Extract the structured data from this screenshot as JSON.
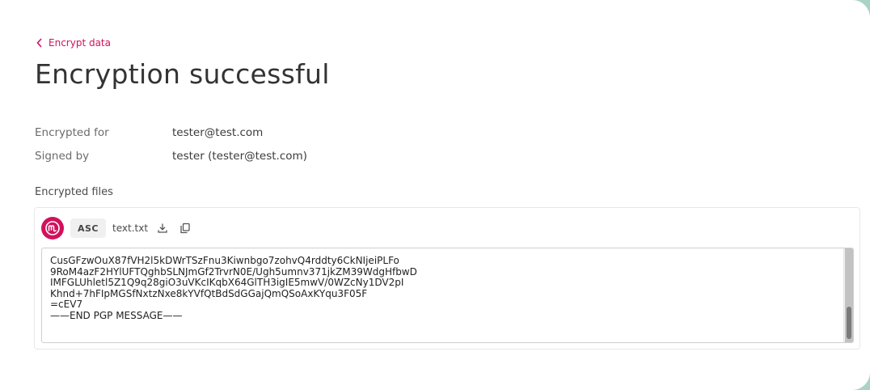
{
  "nav": {
    "back_label": "Encrypt data"
  },
  "page": {
    "title": "Encryption successful"
  },
  "details": {
    "encrypted_for_label": "Encrypted for",
    "encrypted_for_value": "tester@test.com",
    "signed_by_label": "Signed by",
    "signed_by_value": "tester (tester@test.com)"
  },
  "files": {
    "section_label": "Encrypted files",
    "items": [
      {
        "badge": "ASC",
        "filename": "text.txt",
        "content": "CusGFzwOuX87fVH2l5kDWrTSzFnu3Kiwnbgo7zohvQ4rddty6CkNIjeiPLFo\n9RoM4azF2HYlUFTQghbSLNJmGf2TrvrN0E/Ugh5umnv371jkZM39WdgHfbwD\nIMFGLUhletl5Z1Q9q28giO3uVKcIKqbX64GlTH3igIE5mwV/0WZcNy1DV2pI\nKhnd+7hFIpMGSfNxtzNxe8kYVfQtBdSdGGajQmQSoAxKYqu3F05F\n=cEV7\n——END PGP MESSAGE——"
      }
    ]
  },
  "icons": {
    "back": "chevron-left-icon",
    "download": "download-icon",
    "copy": "copy-icon",
    "logo": "mailvelope-logo-icon"
  },
  "colors": {
    "accent": "#d2115d",
    "background": "#a9d3c6"
  }
}
